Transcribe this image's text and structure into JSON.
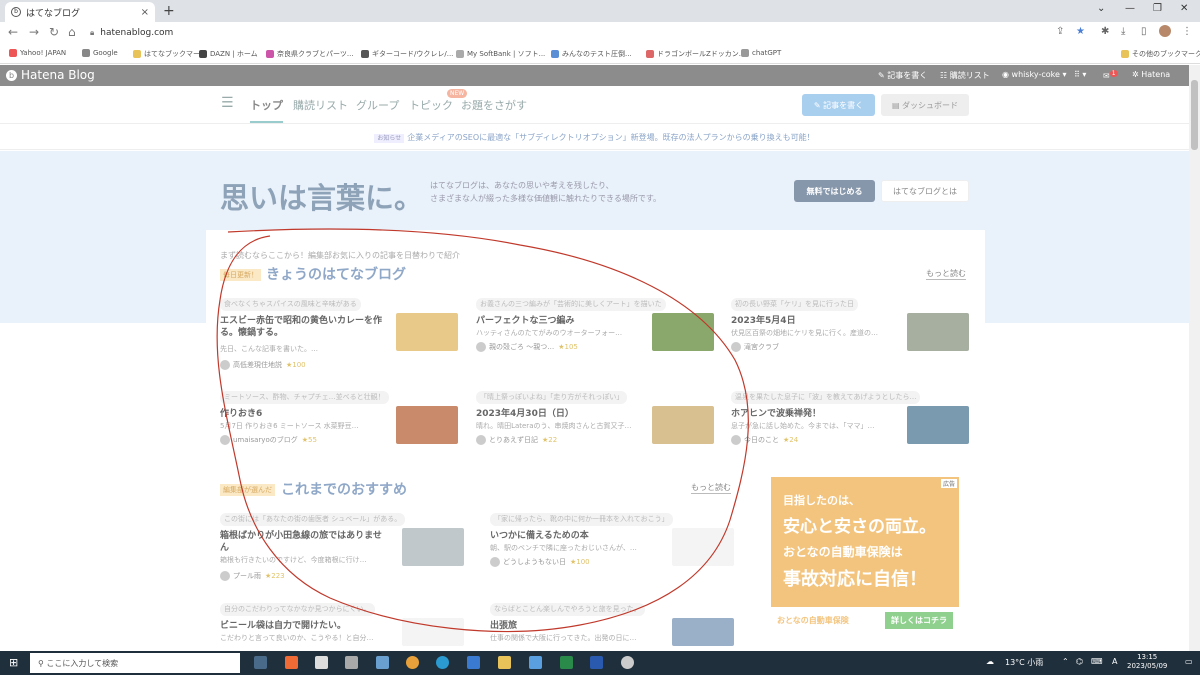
{
  "browser": {
    "tab_title": "はてなブログ",
    "tab_close": "×",
    "new_tab": "+",
    "url": "hatenablog.com",
    "bookmarks": [
      {
        "label": "Yahoo! JAPAN",
        "color": "#e55"
      },
      {
        "label": "Google",
        "color": "#888"
      },
      {
        "label": "はてなブックマーク",
        "color": "#e8c35a"
      },
      {
        "label": "DAZN | ホーム",
        "color": "#444"
      },
      {
        "label": "奈良県クラブとパーツ...",
        "color": "#c5a"
      },
      {
        "label": "ギターコード/ウクレレ/...",
        "color": "#555"
      },
      {
        "label": "My SoftBank | ソフト...",
        "color": "#aaa"
      },
      {
        "label": "みんなのテスト圧倒...",
        "color": "#5a8fd6"
      },
      {
        "label": "ドラゴンボールZドッカン...",
        "color": "#d66"
      },
      {
        "label": "chatGPT",
        "color": "#999"
      }
    ],
    "other_bookmarks": "その他のブックマーク"
  },
  "hatena_bar": {
    "logo": "Hatena Blog",
    "write": "記事を書く",
    "reader": "購読リスト",
    "user": "whisky-coke",
    "notification_count": "1",
    "hatena": "Hatena"
  },
  "subnav": {
    "items": [
      "トップ",
      "購読リスト",
      "グループ",
      "トピック",
      "お題をさがす"
    ],
    "new_badge": "NEW",
    "write_button": "記事を書く",
    "dashboard_button": "ダッシュボード"
  },
  "notice": {
    "tag": "お知らせ",
    "text": "企業メディアのSEOに最適な「サブディレクトリオプション」新登場。既存の法人プランからの乗り換えも可能！"
  },
  "hero": {
    "title": "思いは言葉に。",
    "desc_line1": "はてなブログは、あなたの思いや考えを残したり、",
    "desc_line2": "さまざまな人が綴った多様な価値観に触れたりできる場所です。",
    "start_button": "無料ではじめる",
    "about_button": "はてなブログとは"
  },
  "today": {
    "lead": "まず読むならここから！編集部お気に入りの記事を日替わりで紹介",
    "badge": "毎日更新！",
    "title": "きょうのはてなブログ",
    "more": "もっと読む",
    "articles": [
      {
        "intro": "食べなくちゃスパイスの風味と辛味がある",
        "title": "エスビー赤缶で昭和の黄色いカレーを作る。懐鍋する。",
        "excerpt": "先日、こんな記事を書いた。…",
        "author": "高低差現住地説",
        "stars": "★100",
        "thumb": "#e8c98a"
      },
      {
        "intro": "お義さんの三つ編みが「芸術的に美しくアート」を描いた",
        "title": "パーフェクトな三つ編み",
        "excerpt": "ハッティさんのたてがみのウオーターフォー…",
        "author": "親の殻ごろ 〜親つ…",
        "stars": "★105",
        "thumb": "#8aa86b"
      },
      {
        "intro": "初の長い野菜「ケリ」を見に行った日",
        "title": "2023年5月4日",
        "excerpt": "伏見区百祭の畑地にケリを見に行く。産道の…",
        "author": "滝宮クラブ",
        "stars": "",
        "thumb": "#a7b0a0"
      },
      {
        "intro": "ミートソース、酢物、チャプチェ…並べると壮観！",
        "title": "作りおき6",
        "excerpt": "5月7日 作りおき6 ミートソース 水菜野豆…",
        "author": "umaisaryoのブログ",
        "stars": "★55",
        "thumb": "#c88a6a"
      },
      {
        "intro": "「晴上祭っぽいよね」「走り方がそれっぽい」",
        "title": "2023年4月30日（日）",
        "excerpt": "晴れ。晴田Lateraのう、串焼肉さんと古賀又子…",
        "author": "とりあえず日記",
        "stars": "★22",
        "thumb": "#d8c090"
      },
      {
        "intro": "温泉を果たした息子に「波」を教えてあげようとしたら…",
        "title": "ホアヒンで波乗禅発！",
        "excerpt": "息子が急に話し始めた。今までは、「ママ」…",
        "author": "今日のこと",
        "stars": "★24",
        "thumb": "#7a9ab0"
      }
    ]
  },
  "recommend": {
    "badge": "編集部が選んだ",
    "title": "これまでのおすすめ",
    "more": "もっと読む",
    "articles": [
      {
        "intro": "この街には「あなたの街の歯医者 シュベール」がある。",
        "title": "箱根ばかりが小田急線の旅ではありません",
        "excerpt": "箱根も行きたいのですけど、今度箱根に行け…",
        "author": "プール雨",
        "stars": "★223",
        "thumb": "#c0c8cc"
      },
      {
        "intro": "「家に帰ったら、靴の中に何か一冊本を入れておこう」",
        "title": "いつかに備えるための本",
        "excerpt": "朝、駅のベンチで隣に座ったおじいさんが、…",
        "author": "どうしようもない日",
        "stars": "★100",
        "thumb": "#f4f4f4"
      },
      {
        "intro": "自分のこだわりってなかなか見つからにくい。",
        "title": "ビニール袋は自力で開けたい。",
        "excerpt": "こだわりと言って良いのか、こうやる！と自分…",
        "author": "",
        "stars": "",
        "thumb": "#f4f4f4"
      },
      {
        "intro": "ならばとことん楽しんでやろうと旅を見った。",
        "title": "出張旅",
        "excerpt": "仕事の関係で大阪に行ってきた。出発の日に…",
        "author": "",
        "stars": "",
        "thumb": "#9ab0c8"
      }
    ]
  },
  "ad": {
    "tag": "広告",
    "line1": "目指したのは、",
    "line2": "安心と安さの両立。",
    "line3": "おとなの自動車保険は",
    "line4": "事故対応に自信！",
    "brand": "おとなの自動車保険",
    "cta": "詳しくはコチラ"
  },
  "taskbar": {
    "search_placeholder": "ここに入力して検索",
    "weather": "13°C 小雨",
    "ime": "A",
    "time": "13:15",
    "date": "2023/05/09"
  }
}
